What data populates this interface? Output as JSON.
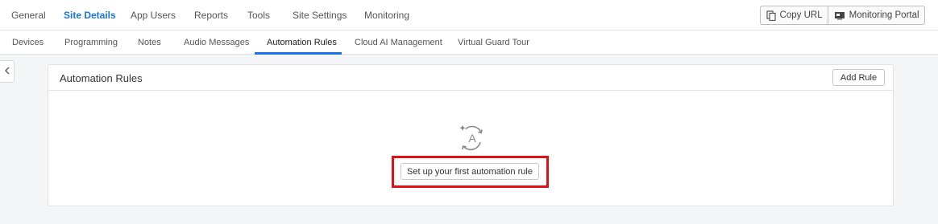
{
  "top_tabs": [
    {
      "label": "General"
    },
    {
      "label": "Site Details",
      "active": true
    },
    {
      "label": "App Users"
    },
    {
      "label": "Reports"
    },
    {
      "label": "Tools"
    },
    {
      "label": "Site Settings"
    },
    {
      "label": "Monitoring"
    }
  ],
  "actions": {
    "copy_url": {
      "label": "Copy URL",
      "icon": "copy-icon"
    },
    "monitoring_portal": {
      "label": "Monitoring Portal",
      "icon": "monitor-icon"
    }
  },
  "sub_tabs": [
    {
      "label": "Devices"
    },
    {
      "label": "Programming"
    },
    {
      "label": "Notes"
    },
    {
      "label": "Audio Messages"
    },
    {
      "label": "Automation Rules",
      "active": true
    },
    {
      "label": "Cloud AI Management"
    },
    {
      "label": "Virtual Guard Tour"
    }
  ],
  "sidebar_toggle": {
    "icon": "chevron-left-icon"
  },
  "card": {
    "title": "Automation Rules",
    "add_rule_label": "Add Rule",
    "empty_state": {
      "icon": "automation-icon",
      "button_label": "Set up your first automation rule"
    }
  },
  "colors": {
    "accent": "#1a73e8",
    "highlight": "#e3101a"
  }
}
